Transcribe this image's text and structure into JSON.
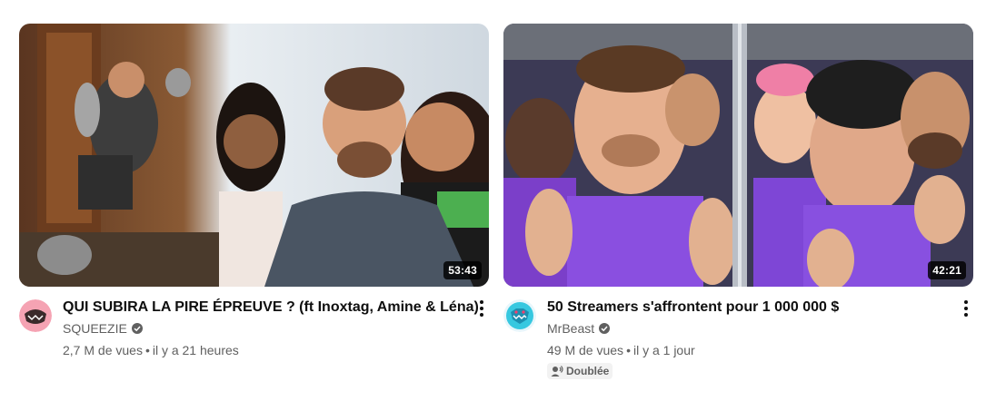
{
  "videos": [
    {
      "title": "QUI SUBIRA LA PIRE ÉPREUVE ? (ft Inoxtag, Amine & Léna)",
      "duration": "53:43",
      "channel": "SQUEEZIE",
      "views": "2,7 M de vues",
      "age": "il y a 21 heures",
      "verified": true
    },
    {
      "title": "50 Streamers s'affrontent pour 1 000 000 $",
      "duration": "42:21",
      "channel": "MrBeast",
      "views": "49 M de vues",
      "age": "il y a 1 jour",
      "verified": true,
      "badge": "Doublée"
    }
  ],
  "stats_separator": "•",
  "icons": {
    "verified": "check-circle-icon",
    "menu": "more-vert-icon",
    "dubbed": "voice-icon"
  },
  "colors": {
    "primary_text": "#0f0f0f",
    "secondary_text": "#606060",
    "duration_bg": "#000000",
    "badge_bg": "#f2f2f2",
    "squeezie_avatar": "#f5a3b3",
    "mrbeast_avatar": "#37c8e0"
  }
}
